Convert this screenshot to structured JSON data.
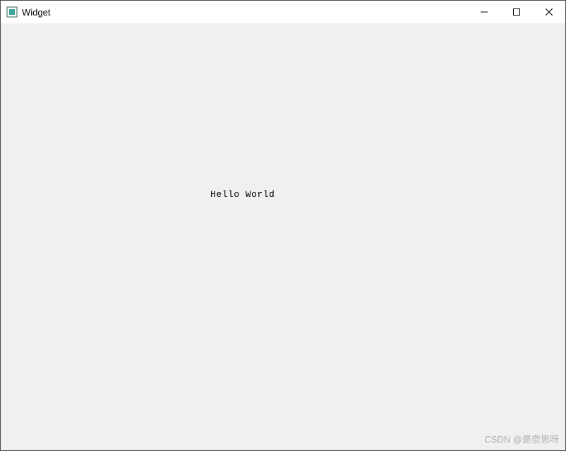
{
  "window": {
    "title": "Widget",
    "icon_name": "qt-app-icon"
  },
  "controls": {
    "minimize": "minimize",
    "maximize": "maximize",
    "close": "close"
  },
  "content": {
    "hello_label": "Hello World"
  },
  "watermark": "CSDN @是奈思呀"
}
